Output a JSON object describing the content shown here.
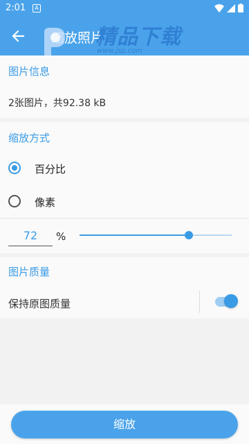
{
  "status_bar": {
    "time": "2:01",
    "notification_letter": "A",
    "icons": [
      "wifi-icon",
      "signal-icon",
      "battery-icon"
    ]
  },
  "app_bar": {
    "title": "缩放照片"
  },
  "watermark": {
    "brand": "精品下载",
    "url": "www.jsp.com"
  },
  "image_info": {
    "title": "图片信息",
    "summary": "2张图片，共92.38 kB"
  },
  "scale_mode": {
    "title": "缩放方式",
    "options": [
      {
        "label": "百分比",
        "selected": true
      },
      {
        "label": "像素",
        "selected": false
      }
    ],
    "percent_value": "72",
    "percent_sign": "%",
    "slider_fraction": 0.72
  },
  "quality": {
    "title": "图片质量",
    "keep_original_label": "保持原图质量",
    "keep_original_on": true
  },
  "actions": {
    "scale_label": "缩放"
  },
  "colors": {
    "accent": "#3a9be5",
    "app_bar": "#4aa3ea"
  }
}
